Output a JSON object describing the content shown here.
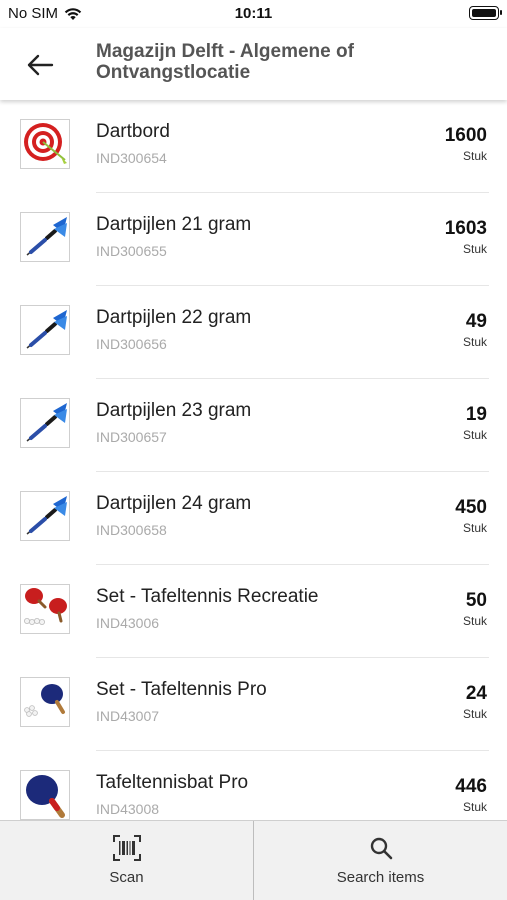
{
  "status_bar": {
    "carrier": "No SIM",
    "time": "10:11"
  },
  "header": {
    "title": "Magazijn Delft - Algemene of Ontvangstlocatie"
  },
  "items": [
    {
      "name": "Dartbord",
      "code": "IND300654",
      "quantity": "1600",
      "unit": "Stuk",
      "image": "dartboard-icon"
    },
    {
      "name": "Dartpijlen 21 gram",
      "code": "IND300655",
      "quantity": "1603",
      "unit": "Stuk",
      "image": "dart-icon"
    },
    {
      "name": "Dartpijlen 22 gram",
      "code": "IND300656",
      "quantity": "49",
      "unit": "Stuk",
      "image": "dart-icon"
    },
    {
      "name": "Dartpijlen 23 gram",
      "code": "IND300657",
      "quantity": "19",
      "unit": "Stuk",
      "image": "dart-icon"
    },
    {
      "name": "Dartpijlen 24 gram",
      "code": "IND300658",
      "quantity": "450",
      "unit": "Stuk",
      "image": "dart-icon"
    },
    {
      "name": "Set - Tafeltennis Recreatie",
      "code": "IND43006",
      "quantity": "50",
      "unit": "Stuk",
      "image": "table-tennis-set-red-icon"
    },
    {
      "name": "Set - Tafeltennis Pro",
      "code": "IND43007",
      "quantity": "24",
      "unit": "Stuk",
      "image": "table-tennis-set-pro-icon"
    },
    {
      "name": "Tafeltennisbat Pro",
      "code": "IND43008",
      "quantity": "446",
      "unit": "Stuk",
      "image": "table-tennis-bat-icon"
    }
  ],
  "bottom_bar": {
    "scan_label": "Scan",
    "search_label": "Search items"
  },
  "colors": {
    "accent_blue": "#1e66d0",
    "dartboard_red": "#d42020",
    "paddle_red": "#c81e1e",
    "paddle_navy": "#1c2a7a"
  }
}
